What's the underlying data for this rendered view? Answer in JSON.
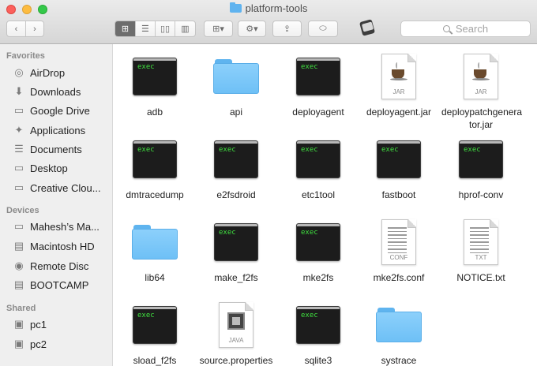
{
  "window": {
    "title": "platform-tools",
    "search_placeholder": "Search"
  },
  "toolbar": {
    "back_icon": "chevron-left-icon",
    "forward_icon": "chevron-right-icon",
    "view_modes": [
      "icon-view-icon",
      "list-view-icon",
      "column-view-icon",
      "cover-flow-icon"
    ],
    "active_view": "icon-view-icon",
    "arrange_icon": "arrange-grid-icon",
    "action_icon": "gear-icon",
    "share_icon": "share-icon",
    "tag_icon": "tag-icon",
    "path_icon": "app-icon"
  },
  "sidebar": {
    "sections": [
      {
        "title": "Favorites",
        "items": [
          {
            "label": "AirDrop",
            "icon": "airdrop-icon"
          },
          {
            "label": "Downloads",
            "icon": "downloads-icon"
          },
          {
            "label": "Google Drive",
            "icon": "folder-icon"
          },
          {
            "label": "Applications",
            "icon": "applications-icon"
          },
          {
            "label": "Documents",
            "icon": "documents-icon"
          },
          {
            "label": "Desktop",
            "icon": "desktop-icon"
          },
          {
            "label": "Creative Clou...",
            "icon": "folder-icon"
          }
        ]
      },
      {
        "title": "Devices",
        "items": [
          {
            "label": "Mahesh’s Ma...",
            "icon": "laptop-icon"
          },
          {
            "label": "Macintosh HD",
            "icon": "harddisk-icon"
          },
          {
            "label": "Remote Disc",
            "icon": "disc-icon"
          },
          {
            "label": "BOOTCAMP",
            "icon": "harddisk-icon"
          }
        ]
      },
      {
        "title": "Shared",
        "items": [
          {
            "label": "pc1",
            "icon": "computer-icon"
          },
          {
            "label": "pc2",
            "icon": "computer-icon"
          }
        ]
      }
    ]
  },
  "files": [
    {
      "name": "adb",
      "kind": "exec",
      "tag": "exec"
    },
    {
      "name": "api",
      "kind": "folder"
    },
    {
      "name": "deployagent",
      "kind": "exec",
      "tag": "exec"
    },
    {
      "name": "deployagent.jar",
      "kind": "jar",
      "tag": "JAR"
    },
    {
      "name": "deploypatchgenerator.jar",
      "kind": "jar",
      "tag": "JAR"
    },
    {
      "name": "dmtracedump",
      "kind": "exec",
      "tag": "exec"
    },
    {
      "name": "e2fsdroid",
      "kind": "exec",
      "tag": "exec"
    },
    {
      "name": "etc1tool",
      "kind": "exec",
      "tag": "exec"
    },
    {
      "name": "fastboot",
      "kind": "exec",
      "tag": "exec"
    },
    {
      "name": "hprof-conv",
      "kind": "exec",
      "tag": "exec"
    },
    {
      "name": "lib64",
      "kind": "folder"
    },
    {
      "name": "make_f2fs",
      "kind": "exec",
      "tag": "exec"
    },
    {
      "name": "mke2fs",
      "kind": "exec",
      "tag": "exec"
    },
    {
      "name": "mke2fs.conf",
      "kind": "doc",
      "tag": "CONF"
    },
    {
      "name": "NOTICE.txt",
      "kind": "doc",
      "tag": "TXT"
    },
    {
      "name": "sload_f2fs",
      "kind": "exec",
      "tag": "exec"
    },
    {
      "name": "source.properties",
      "kind": "java",
      "tag": "JAVA"
    },
    {
      "name": "sqlite3",
      "kind": "exec",
      "tag": "exec"
    },
    {
      "name": "systrace",
      "kind": "folder"
    }
  ]
}
